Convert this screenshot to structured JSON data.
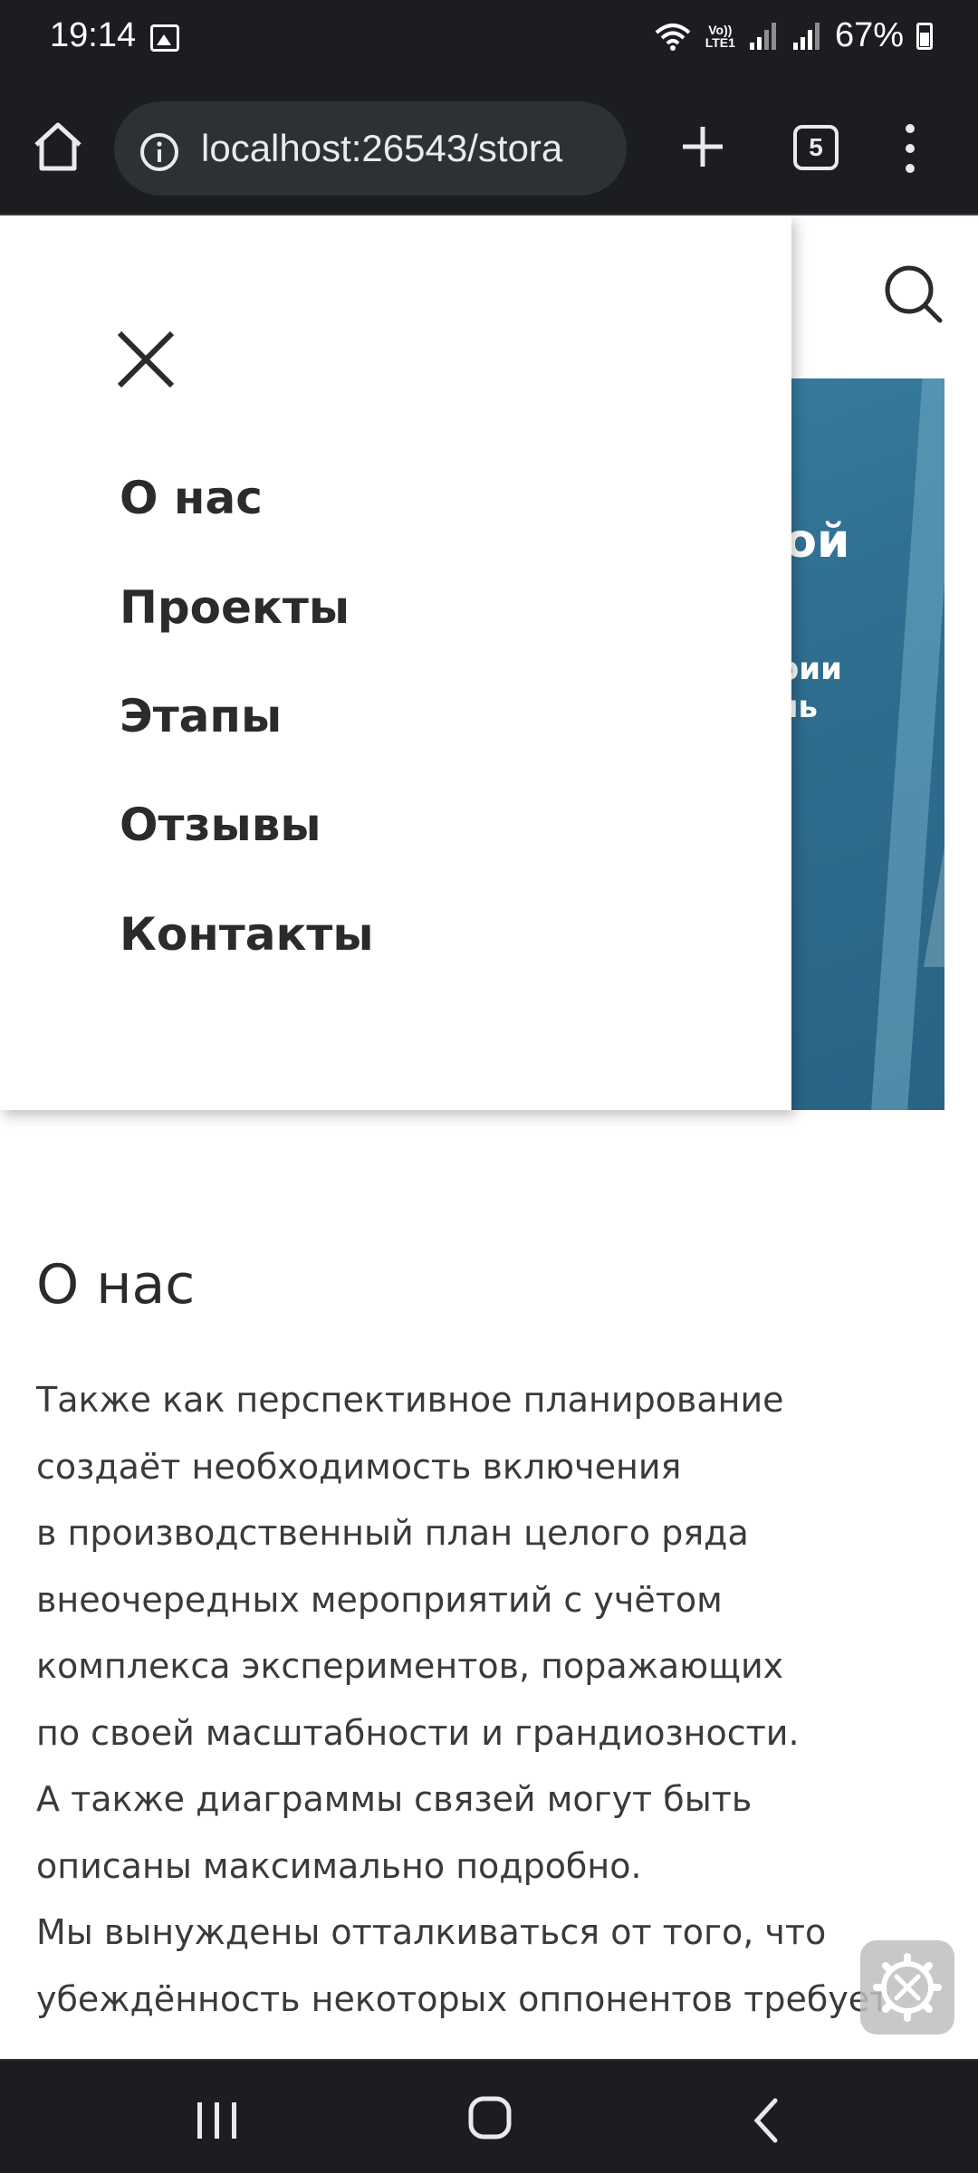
{
  "status_bar": {
    "time": "19:14",
    "lte": "Vo))\nLTE1",
    "battery": "67%"
  },
  "browser": {
    "url": "localhost:26543/stora",
    "tab_count": "5"
  },
  "hero": {
    "title_fragment": "бой",
    "subtitle_fragment": "арии\nень"
  },
  "drawer": {
    "items": [
      "О нас",
      "Проекты",
      "Этапы",
      "Отзывы",
      "Контакты"
    ]
  },
  "about": {
    "title": "О нас",
    "text": "Также как перспективное планирование\nсоздаёт необходимость включения\nв производственный план целого ряда\nвнеочередных мероприятий с учётом\nкомплекса экспериментов, поражающих\nпо своей масштабности и грандиозности.\nА также диаграммы связей могут быть\nописаны максимально подробно.\nМы вынуждены отталкиваться от того, что\nубеждённость некоторых оппонентов требует"
  },
  "colors": {
    "system_bar": "#1b1d20",
    "url_bar": "#2c3135",
    "hero": "#2f6f90",
    "text_dark": "#2b2b2b"
  },
  "icons": [
    "home-icon",
    "info-icon",
    "plus-icon",
    "tabs-icon",
    "more-vert-icon",
    "search-icon",
    "close-icon",
    "settings-icon",
    "recents-icon",
    "home-nav-icon",
    "back-icon"
  ]
}
